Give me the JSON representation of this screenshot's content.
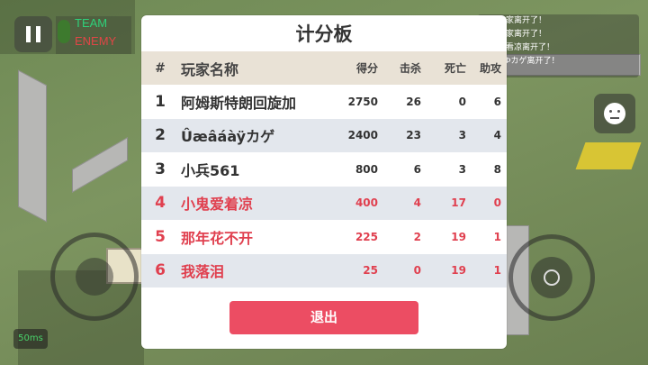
{
  "hud": {
    "team_label": "TEAM",
    "enemy_label": "ENEMY",
    "ping": "50ms",
    "feed": [
      "家离开了！",
      "家离开了！",
      "看凉离开了！",
      "Þカゲ离开了！"
    ]
  },
  "scoreboard": {
    "title": "计分板",
    "columns": {
      "rank": "#",
      "name": "玩家名称",
      "score": "得分",
      "kills": "击杀",
      "deaths": "死亡",
      "assists": "助攻"
    },
    "rows": [
      {
        "rank": "1",
        "name": "阿姆斯特朗回旋加",
        "score": "2750",
        "kills": "26",
        "deaths": "0",
        "assists": "6",
        "team": "ally"
      },
      {
        "rank": "2",
        "name": "Ûæâáàÿカゲ",
        "score": "2400",
        "kills": "23",
        "deaths": "3",
        "assists": "4",
        "team": "ally"
      },
      {
        "rank": "3",
        "name": "小兵561",
        "score": "800",
        "kills": "6",
        "deaths": "3",
        "assists": "8",
        "team": "ally"
      },
      {
        "rank": "4",
        "name": "小鬼爱着凉",
        "score": "400",
        "kills": "4",
        "deaths": "17",
        "assists": "0",
        "team": "enemy"
      },
      {
        "rank": "5",
        "name": "那年花不开",
        "score": "225",
        "kills": "2",
        "deaths": "19",
        "assists": "1",
        "team": "enemy"
      },
      {
        "rank": "6",
        "name": "我落泪",
        "score": "25",
        "kills": "0",
        "deaths": "19",
        "assists": "1",
        "team": "enemy"
      }
    ],
    "exit_label": "退出"
  },
  "colors": {
    "enemy_text": "#e0404f",
    "exit_button": "#ec4d63",
    "header_bg": "#e9e2d6",
    "alt_row_bg": "#e3e7ed"
  }
}
